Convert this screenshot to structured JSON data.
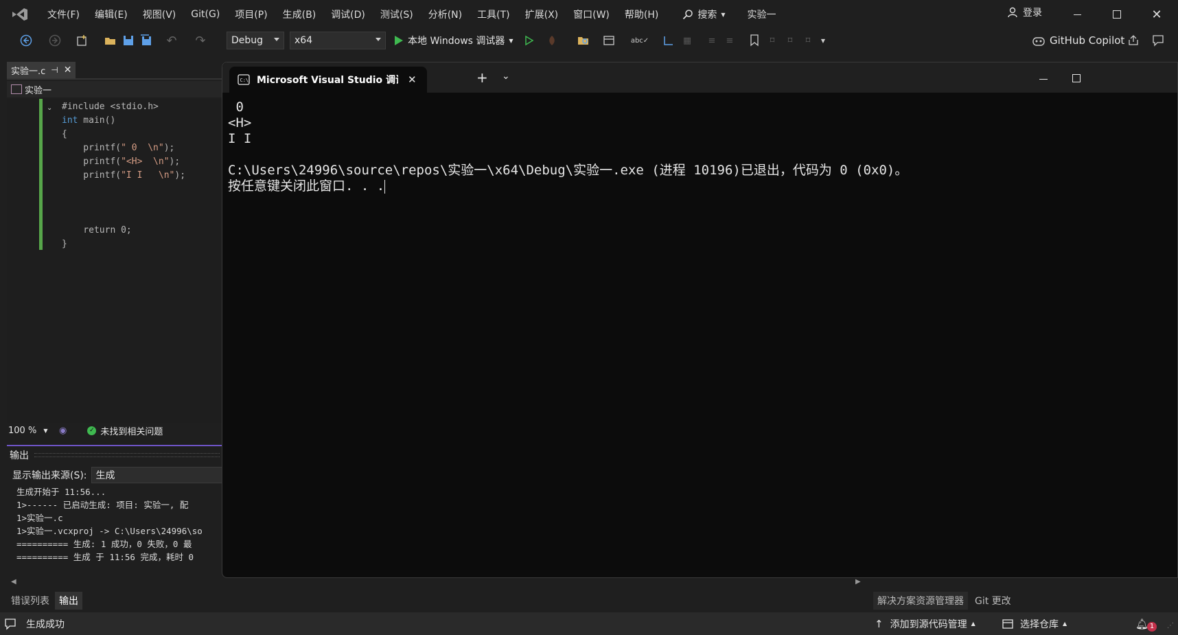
{
  "menu": [
    "文件(F)",
    "编辑(E)",
    "视图(V)",
    "Git(G)",
    "项目(P)",
    "生成(B)",
    "调试(D)",
    "测试(S)",
    "分析(N)",
    "工具(T)",
    "扩展(X)",
    "窗口(W)",
    "帮助(H)"
  ],
  "search_label": "搜索",
  "solution_title": "实验一",
  "login_label": "登录",
  "toolbar": {
    "config": "Debug",
    "platform": "x64",
    "run_label": "本地 Windows 调试器",
    "copilot_label": "GitHub Copilot"
  },
  "editor": {
    "tab_label": "实验一.c",
    "nav_label": "实验一",
    "zoom": "100 %",
    "issues": "未找到相关问题"
  },
  "code": {
    "line1": "#include <stdio.h>",
    "line2_kw": "int",
    "line2_rest": " main()",
    "line3": "{",
    "line4_fn": "    printf(",
    "line4_str": "\" 0  \\n\"",
    "line4_end": ");",
    "line5_fn": "    printf(",
    "line5_str": "\"<H>  \\n\"",
    "line5_end": ");",
    "line6_fn": "    printf(",
    "line6_str": "\"I I   \\n\"",
    "line6_end": ");",
    "line10": "    return 0;",
    "line11": "}"
  },
  "output": {
    "header": "输出",
    "source_label": "显示输出来源(S):",
    "source_value": "生成",
    "lines": [
      "生成开始于 11:56...",
      "1>------ 已启动生成: 项目: 实验一, 配",
      "1>实验一.c",
      "1>实验一.vcxproj -> C:\\Users\\24996\\so",
      "========== 生成: 1 成功，0 失败，0 最",
      "========== 生成 于 11:56 完成，耗时 0"
    ]
  },
  "bottom_tabs": [
    "错误列表",
    "输出"
  ],
  "right_tabs": [
    "解决方案资源管理器",
    "Git 更改"
  ],
  "console": {
    "tab_title": "Microsoft Visual Studio 调试控",
    "lines": [
      " 0",
      "<H>",
      "I I",
      "",
      "C:\\Users\\24996\\source\\repos\\实验一\\x64\\Debug\\实验一.exe (进程 10196)已退出，代码为 0 (0x0)。",
      "按任意键关闭此窗口. . ."
    ]
  },
  "status": {
    "build": "生成成功",
    "add_source": "添加到源代码管理",
    "select_repo": "选择仓库",
    "notifications": "1"
  },
  "colors": {
    "accent_purple": "#6e54c6",
    "change_bar": "#57a64a",
    "keyword": "#569cd6",
    "string": "#d69d85"
  }
}
